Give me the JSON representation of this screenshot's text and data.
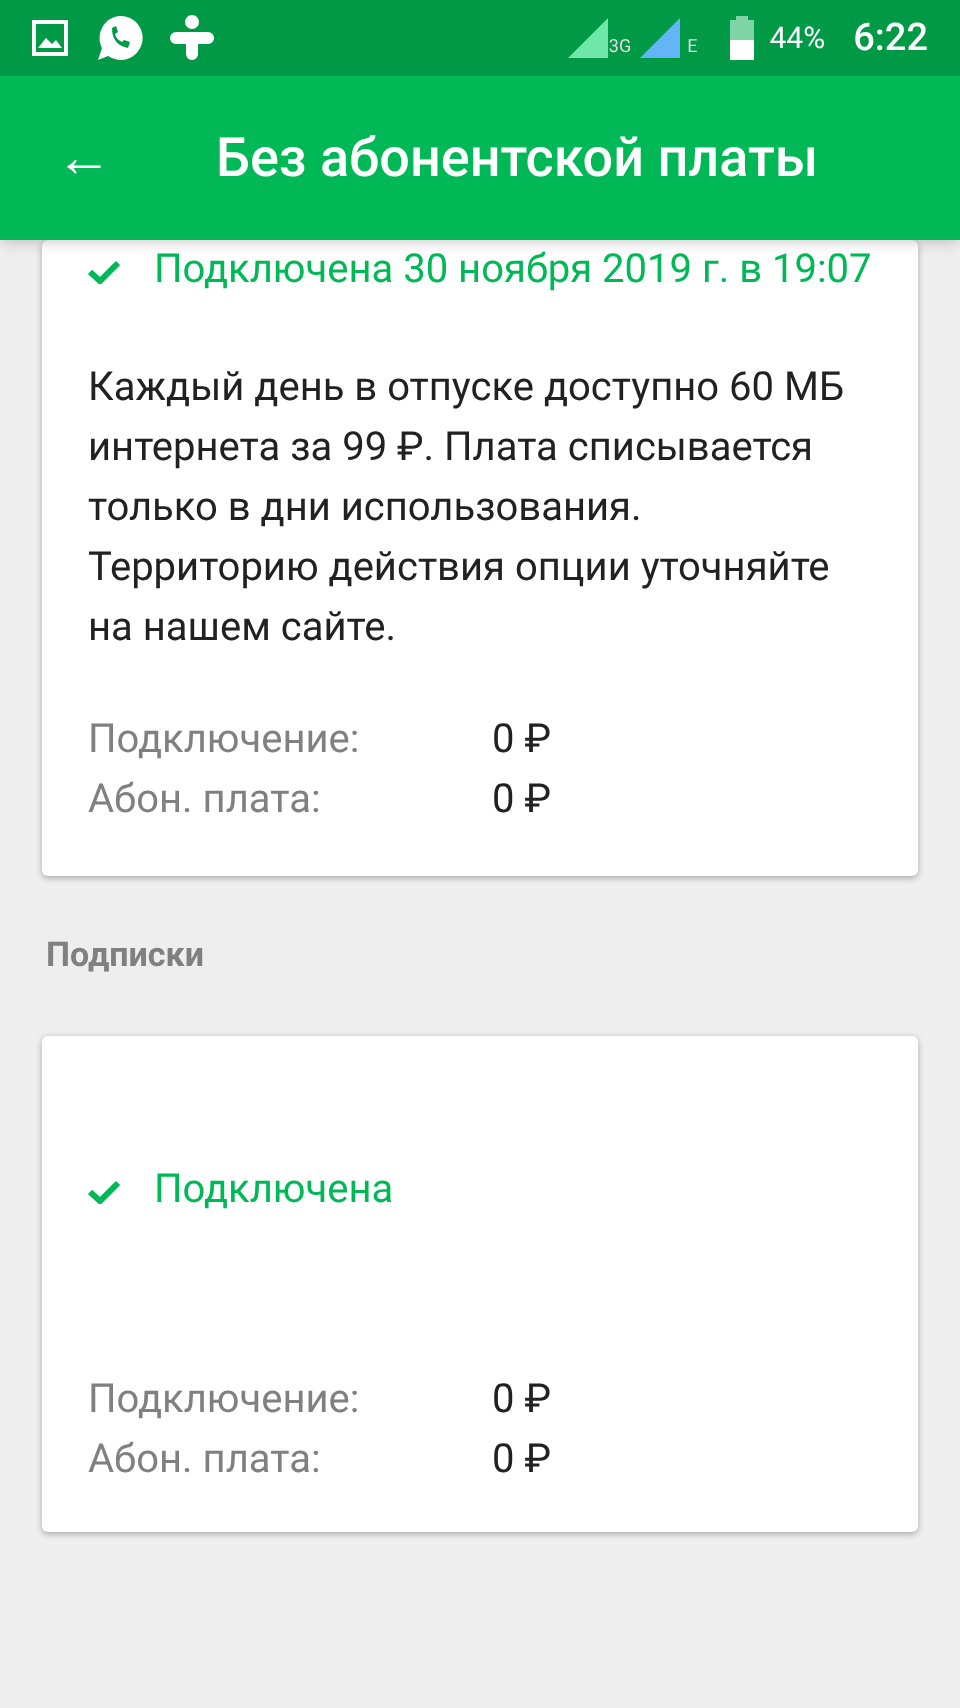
{
  "status_bar": {
    "network_1": "3G",
    "network_2": "E",
    "battery": "44%",
    "time": "6:22"
  },
  "app_bar": {
    "back": "←",
    "title": "Без абонентской платы"
  },
  "cards": [
    {
      "connected": true,
      "status": "Подключена 30 ноября 2019 г. в 19:07",
      "description": "Каждый день в отпуске доступно 60 МБ интернета за 99 ₽. Плата списывается только в дни использования. Территорию действия опции уточняйте на нашем сайте.",
      "fees": [
        {
          "label": "Подключение:",
          "value": "0 ₽"
        },
        {
          "label": "Абон. плата:",
          "value": "0 ₽"
        }
      ]
    },
    {
      "section": "Подписки",
      "connected": true,
      "status": "Подключена",
      "fees": [
        {
          "label": "Подключение:",
          "value": "0 ₽"
        },
        {
          "label": "Абон. плата:",
          "value": "0 ₽"
        }
      ]
    }
  ]
}
